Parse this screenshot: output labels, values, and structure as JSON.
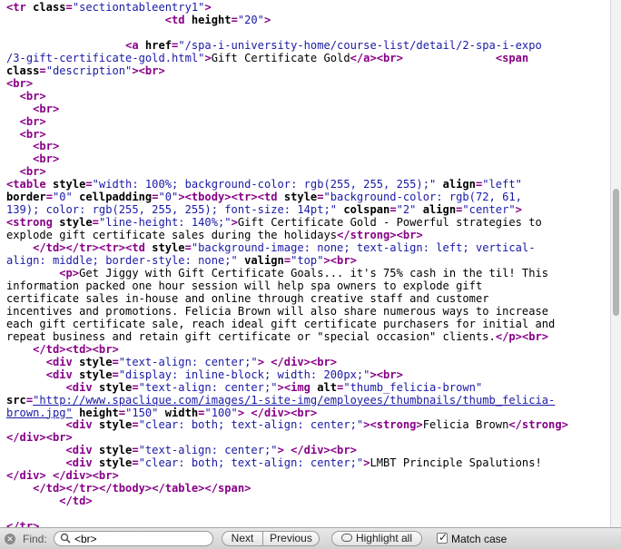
{
  "lines": [
    [
      [
        "tag",
        "<tr "
      ],
      [
        "att",
        "class"
      ],
      [
        "tag",
        "="
      ],
      [
        "val",
        "\"sectiontableentry1\""
      ],
      [
        "tag",
        ">"
      ]
    ],
    [
      [
        "txt",
        "                        "
      ],
      [
        "tag",
        "<td "
      ],
      [
        "att",
        "height"
      ],
      [
        "tag",
        "="
      ],
      [
        "val",
        "\"20\""
      ],
      [
        "tag",
        ">"
      ]
    ],
    [],
    [
      [
        "txt",
        "                  "
      ],
      [
        "tag",
        "<a "
      ],
      [
        "att",
        "href"
      ],
      [
        "tag",
        "="
      ],
      [
        "val",
        "\"/spa-i-university-home/course-list/detail/2-spa-i-expo"
      ]
    ],
    [
      [
        "val",
        "/3-gift-certificate-gold.html\""
      ],
      [
        "tag",
        ">"
      ],
      [
        "txt",
        "Gift Certificate Gold"
      ],
      [
        "tag",
        "</a>"
      ],
      [
        "tag",
        "<br>"
      ],
      [
        "txt",
        "              "
      ],
      [
        "tag",
        "<span"
      ]
    ],
    [
      [
        "att",
        "class"
      ],
      [
        "tag",
        "="
      ],
      [
        "val",
        "\"description\""
      ],
      [
        "tag",
        ">"
      ],
      [
        "tag",
        "<br>"
      ]
    ],
    [
      [
        "tag",
        "<br>"
      ]
    ],
    [
      [
        "txt",
        "  "
      ],
      [
        "tag",
        "<br>"
      ]
    ],
    [
      [
        "txt",
        "    "
      ],
      [
        "tag",
        "<br>"
      ]
    ],
    [
      [
        "txt",
        "  "
      ],
      [
        "tag",
        "<br>"
      ]
    ],
    [
      [
        "txt",
        "  "
      ],
      [
        "tag",
        "<br>"
      ]
    ],
    [
      [
        "txt",
        "    "
      ],
      [
        "tag",
        "<br>"
      ]
    ],
    [
      [
        "txt",
        "    "
      ],
      [
        "tag",
        "<br>"
      ]
    ],
    [
      [
        "txt",
        "  "
      ],
      [
        "tag",
        "<br>"
      ]
    ],
    [
      [
        "tag",
        "<table "
      ],
      [
        "att",
        "style"
      ],
      [
        "tag",
        "="
      ],
      [
        "val",
        "\"width: 100%; background-color: rgb(255, 255, 255);\""
      ],
      [
        "txt",
        " "
      ],
      [
        "att",
        "align"
      ],
      [
        "tag",
        "="
      ],
      [
        "val",
        "\"left\""
      ]
    ],
    [
      [
        "att",
        "border"
      ],
      [
        "tag",
        "="
      ],
      [
        "val",
        "\"0\""
      ],
      [
        "txt",
        " "
      ],
      [
        "att",
        "cellpadding"
      ],
      [
        "tag",
        "="
      ],
      [
        "val",
        "\"0\""
      ],
      [
        "tag",
        ">"
      ],
      [
        "tag",
        "<tbody>"
      ],
      [
        "tag",
        "<tr>"
      ],
      [
        "tag",
        "<td "
      ],
      [
        "att",
        "style"
      ],
      [
        "tag",
        "="
      ],
      [
        "val",
        "\"background-color: rgb(72, 61,"
      ]
    ],
    [
      [
        "val",
        "139); color: rgb(255, 255, 255); font-size: 14pt;\""
      ],
      [
        "txt",
        " "
      ],
      [
        "att",
        "colspan"
      ],
      [
        "tag",
        "="
      ],
      [
        "val",
        "\"2\""
      ],
      [
        "txt",
        " "
      ],
      [
        "att",
        "align"
      ],
      [
        "tag",
        "="
      ],
      [
        "val",
        "\"center\""
      ],
      [
        "tag",
        ">"
      ]
    ],
    [
      [
        "tag",
        "<strong "
      ],
      [
        "att",
        "style"
      ],
      [
        "tag",
        "="
      ],
      [
        "val",
        "\"line-height: 140%;\""
      ],
      [
        "tag",
        ">"
      ],
      [
        "txt",
        "Gift Certificate Gold - Powerful strategies to"
      ]
    ],
    [
      [
        "txt",
        "explode gift certificate sales during the holidays"
      ],
      [
        "tag",
        "</strong>"
      ],
      [
        "tag",
        "<br>"
      ]
    ],
    [
      [
        "txt",
        "    "
      ],
      [
        "tag",
        "</td>"
      ],
      [
        "tag",
        "</tr>"
      ],
      [
        "tag",
        "<tr>"
      ],
      [
        "tag",
        "<td "
      ],
      [
        "att",
        "style"
      ],
      [
        "tag",
        "="
      ],
      [
        "val",
        "\"background-image: none; text-align: left; vertical-"
      ]
    ],
    [
      [
        "val",
        "align: middle; border-style: none;\""
      ],
      [
        "txt",
        " "
      ],
      [
        "att",
        "valign"
      ],
      [
        "tag",
        "="
      ],
      [
        "val",
        "\"top\""
      ],
      [
        "tag",
        ">"
      ],
      [
        "tag",
        "<br>"
      ]
    ],
    [
      [
        "txt",
        "        "
      ],
      [
        "tag",
        "<p>"
      ],
      [
        "txt",
        "Get Jiggy with Gift Certificate Goals... it's 75% cash in the til! This"
      ]
    ],
    [
      [
        "txt",
        "information packed one hour session will help spa owners to explode gift"
      ]
    ],
    [
      [
        "txt",
        "certificate sales in-house and online through creative staff and customer"
      ]
    ],
    [
      [
        "txt",
        "incentives and promotions. Felicia Brown will also share numerous ways to increase"
      ]
    ],
    [
      [
        "txt",
        "each gift certificate sale, reach ideal gift certificate purchasers for initial and"
      ]
    ],
    [
      [
        "txt",
        "repeat business and retain gift certificate or \"special occasion\" clients."
      ],
      [
        "tag",
        "</p>"
      ],
      [
        "tag",
        "<br>"
      ]
    ],
    [
      [
        "txt",
        "    "
      ],
      [
        "tag",
        "</td>"
      ],
      [
        "tag",
        "<td>"
      ],
      [
        "tag",
        "<br>"
      ]
    ],
    [
      [
        "txt",
        "      "
      ],
      [
        "tag",
        "<div "
      ],
      [
        "att",
        "style"
      ],
      [
        "tag",
        "="
      ],
      [
        "val",
        "\"text-align: center;\""
      ],
      [
        "tag",
        ">"
      ],
      [
        "txt",
        " "
      ],
      [
        "tag",
        "</div>"
      ],
      [
        "tag",
        "<br>"
      ]
    ],
    [
      [
        "txt",
        "      "
      ],
      [
        "tag",
        "<div "
      ],
      [
        "att",
        "style"
      ],
      [
        "tag",
        "="
      ],
      [
        "val",
        "\"display: inline-block; width: 200px;\""
      ],
      [
        "tag",
        ">"
      ],
      [
        "tag",
        "<br>"
      ]
    ],
    [
      [
        "txt",
        "         "
      ],
      [
        "tag",
        "<div "
      ],
      [
        "att",
        "style"
      ],
      [
        "tag",
        "="
      ],
      [
        "val",
        "\"text-align: center;\""
      ],
      [
        "tag",
        ">"
      ],
      [
        "tag",
        "<img "
      ],
      [
        "att",
        "alt"
      ],
      [
        "tag",
        "="
      ],
      [
        "val",
        "\"thumb_felicia-brown\""
      ]
    ],
    [
      [
        "att",
        "src"
      ],
      [
        "tag",
        "="
      ],
      [
        "lnk",
        "\"http://www.spaclique.com/images/1-site-img/employees/thumbnails/thumb_felicia-"
      ]
    ],
    [
      [
        "lnk",
        "brown.jpg\""
      ],
      [
        "txt",
        " "
      ],
      [
        "att",
        "height"
      ],
      [
        "tag",
        "="
      ],
      [
        "val",
        "\"150\""
      ],
      [
        "txt",
        " "
      ],
      [
        "att",
        "width"
      ],
      [
        "tag",
        "="
      ],
      [
        "val",
        "\"100\""
      ],
      [
        "tag",
        ">"
      ],
      [
        "txt",
        " "
      ],
      [
        "tag",
        "</div>"
      ],
      [
        "tag",
        "<br>"
      ]
    ],
    [
      [
        "txt",
        "         "
      ],
      [
        "tag",
        "<div "
      ],
      [
        "att",
        "style"
      ],
      [
        "tag",
        "="
      ],
      [
        "val",
        "\"clear: both; text-align: center;\""
      ],
      [
        "tag",
        ">"
      ],
      [
        "tag",
        "<strong>"
      ],
      [
        "txt",
        "Felicia Brown"
      ],
      [
        "tag",
        "</strong>"
      ]
    ],
    [
      [
        "tag",
        "</div>"
      ],
      [
        "tag",
        "<br>"
      ]
    ],
    [
      [
        "txt",
        "         "
      ],
      [
        "tag",
        "<div "
      ],
      [
        "att",
        "style"
      ],
      [
        "tag",
        "="
      ],
      [
        "val",
        "\"text-align: center;\""
      ],
      [
        "tag",
        ">"
      ],
      [
        "txt",
        " "
      ],
      [
        "tag",
        "</div>"
      ],
      [
        "tag",
        "<br>"
      ]
    ],
    [
      [
        "txt",
        "         "
      ],
      [
        "tag",
        "<div "
      ],
      [
        "att",
        "style"
      ],
      [
        "tag",
        "="
      ],
      [
        "val",
        "\"clear: both; text-align: center;\""
      ],
      [
        "tag",
        ">"
      ],
      [
        "txt",
        "LMBT Principle Spalutions!"
      ]
    ],
    [
      [
        "tag",
        "</div>"
      ],
      [
        "txt",
        " "
      ],
      [
        "tag",
        "</div>"
      ],
      [
        "tag",
        "<br>"
      ]
    ],
    [
      [
        "txt",
        "    "
      ],
      [
        "tag",
        "</td>"
      ],
      [
        "tag",
        "</tr>"
      ],
      [
        "tag",
        "</tbody>"
      ],
      [
        "tag",
        "</table>"
      ],
      [
        "tag",
        "</span>"
      ]
    ],
    [
      [
        "txt",
        "        "
      ],
      [
        "tag",
        "</td>"
      ]
    ],
    [],
    [
      [
        "tag",
        "</tr>"
      ]
    ]
  ],
  "findbar": {
    "close_glyph": "✕",
    "label": "Find:",
    "query": "<br>",
    "next_label": "Next",
    "previous_label": "Previous",
    "highlight_label": "Highlight all",
    "match_case_label": "Match case",
    "match_case_checked": true
  }
}
